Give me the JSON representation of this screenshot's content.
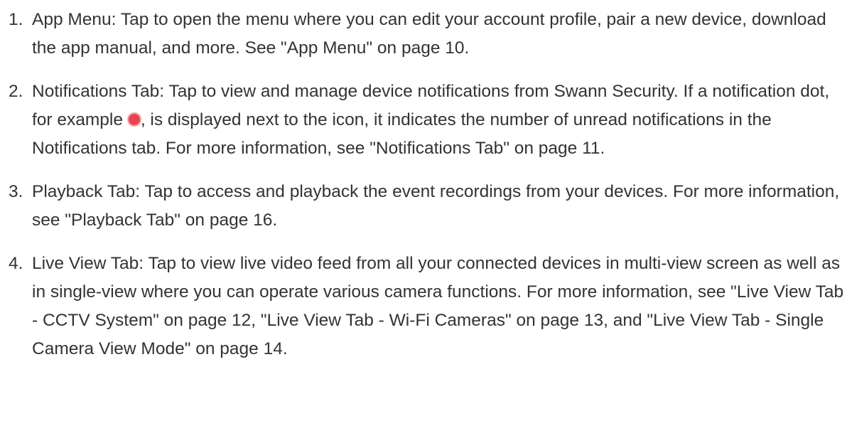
{
  "colors": {
    "text": "#333333",
    "notification_dot": "#e8414f"
  },
  "items": [
    {
      "number": "1.",
      "text": "App Menu: Tap to open the menu where you can edit your account profile, pair a new device, download the app manual, and more. See \"App Menu\" on page 10."
    },
    {
      "number": "2.",
      "text_before": "Notifications Tab: Tap to view and manage device notifications from Swann Security. If a notification dot, for example ",
      "icon": "notification-dot-icon",
      "text_after": ", is displayed next to the icon, it indicates the number of unread notifications in the Notifications tab. For more information, see \"Notifications Tab\" on page 11."
    },
    {
      "number": "3.",
      "text": "Playback Tab: Tap to access and playback the event recordings from your devices. For more information, see \"Playback Tab\" on page 16."
    },
    {
      "number": "4.",
      "text": "Live View Tab: Tap to view live video feed from all your connected devices in multi-view screen as well as in single-view where you can operate various camera functions. For more information, see \"Live View Tab - CCTV System\" on page 12, \"Live View Tab - Wi-Fi Cameras\" on page 13, and \"Live View Tab - Single Camera View Mode\" on page 14."
    }
  ]
}
